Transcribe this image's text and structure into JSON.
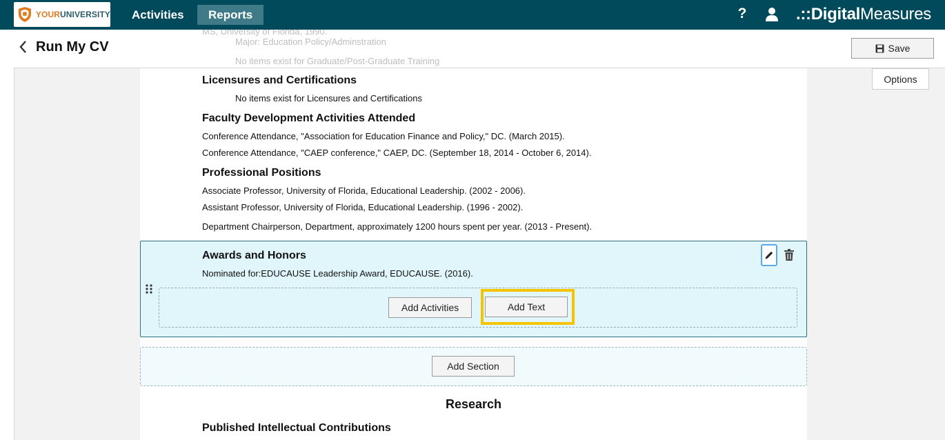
{
  "topbar": {
    "logo": {
      "text_your": "YOUR",
      "text_university": "UNIVERSITY",
      "icon": "shield-logo-icon"
    },
    "nav": [
      {
        "label": "Activities",
        "active": false
      },
      {
        "label": "Reports",
        "active": true
      }
    ],
    "help_label": "?",
    "brand": {
      "dots": ".::",
      "part1": "Digital",
      "part2": "Measures"
    }
  },
  "header": {
    "title": "Run My CV",
    "save_label": "Save",
    "ghost_lines": [
      "MS, University of Florida, 1990.",
      "Major: Education Policy/Adminstration",
      "No items exist for Graduate/Post-Graduate Training"
    ]
  },
  "options_label": "Options",
  "sections": {
    "licensures": {
      "title": "Licensures and Certifications",
      "empty": "No items exist for Licensures and Certifications"
    },
    "faculty_dev": {
      "title": "Faculty Development Activities Attended",
      "items": [
        "Conference Attendance, \"Association for Education Finance and Policy,\" DC. (March 2015).",
        "Conference Attendance, \"CAEP conference,\" CAEP, DC. (September 18, 2014 - October 6, 2014)."
      ]
    },
    "positions": {
      "title": "Professional Positions",
      "items": [
        "Associate Professor, University of Florida, Educational Leadership. (2002 - 2006).",
        "Assistant Professor, University of Florida, Educational Leadership. (1996 - 2002).",
        "Department Chairperson, Department, approximately 1200 hours spent per year. (2013 - Present)."
      ]
    },
    "awards": {
      "title": "Awards and Honors",
      "items": [
        "Nominated for:EDUCAUSE Leadership Award, EDUCAUSE. (2016)."
      ],
      "add_activities_label": "Add Activities",
      "add_text_label": "Add Text"
    },
    "add_section_label": "Add Section",
    "research": {
      "title": "Research",
      "sub_title": "Published Intellectual Contributions"
    }
  },
  "colors": {
    "topbar": "#004a5c",
    "active_nav": "#3f7a88",
    "awards_bg": "#e0f6fb",
    "highlight": "#f5c400",
    "edit_focus": "#5aa9e6"
  }
}
